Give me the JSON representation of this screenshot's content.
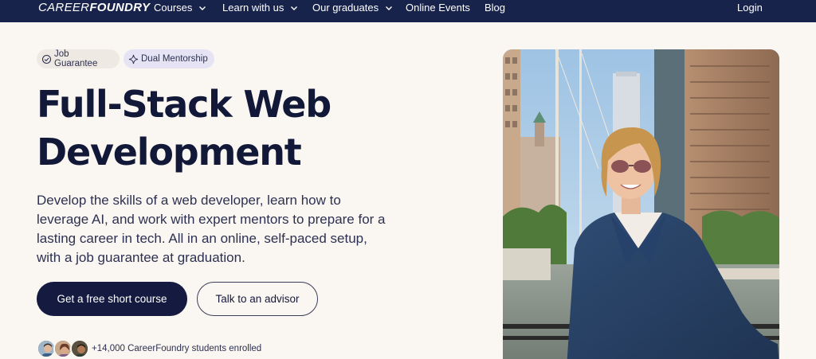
{
  "nav": {
    "logo_thin": "CAREER",
    "logo_bold": "FOUNDRY",
    "items": [
      {
        "label": "Courses",
        "has_dropdown": true
      },
      {
        "label": "Learn with us",
        "has_dropdown": true
      },
      {
        "label": "Our graduates",
        "has_dropdown": true
      },
      {
        "label": "Online Events",
        "has_dropdown": false
      },
      {
        "label": "Blog",
        "has_dropdown": false
      }
    ],
    "login": "Login"
  },
  "badges": [
    {
      "label": "Job Guarantee",
      "icon": "check-circle-icon"
    },
    {
      "label": "Dual Mentorship",
      "icon": "sparkle-icon"
    }
  ],
  "hero": {
    "title_line1": "Full-Stack Web",
    "title_line2": "Development",
    "description": "Develop the skills of a web developer, learn how to leverage AI, and work with expert mentors to prepare for a lasting career in tech. All in an online, self-paced setup, with a job guarantee at graduation.",
    "primary_cta": "Get a free short course",
    "secondary_cta": "Talk to an advisor",
    "enrolled": "+14,000 CareerFoundry students enrolled"
  },
  "colors": {
    "nav_bg": "#17234b",
    "page_bg": "#faf6f2",
    "primary_btn": "#151b40",
    "mentor_badge_bg": "#e6e4f4"
  }
}
